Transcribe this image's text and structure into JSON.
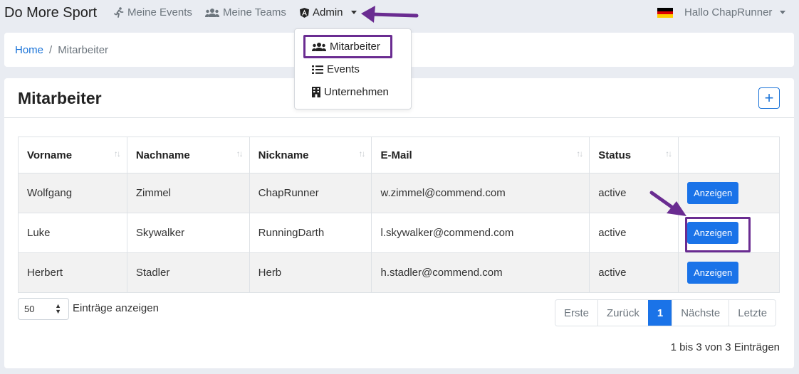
{
  "navbar": {
    "brand": "Do More Sport",
    "links": [
      {
        "label": "Meine Events",
        "icon": "running-icon"
      },
      {
        "label": "Meine Teams",
        "icon": "users-icon"
      },
      {
        "label": "Admin",
        "icon": "angular-icon"
      }
    ],
    "user_greeting": "Hallo ChapRunner",
    "language_flag": "german-flag-icon"
  },
  "dropdown": {
    "items": [
      {
        "label": "Mitarbeiter",
        "icon": "users-icon"
      },
      {
        "label": "Events",
        "icon": "list-icon"
      },
      {
        "label": "Unternehmen",
        "icon": "building-icon"
      }
    ]
  },
  "breadcrumb": {
    "home": "Home",
    "separator": "/",
    "current": "Mitarbeiter"
  },
  "page": {
    "title": "Mitarbeiter",
    "add_label": "+"
  },
  "table": {
    "headers": [
      "Vorname",
      "Nachname",
      "Nickname",
      "E-Mail",
      "Status"
    ],
    "sort_glyph": "↑↓",
    "rows": [
      {
        "vorname": "Wolfgang",
        "nachname": "Zimmel",
        "nickname": "ChapRunner",
        "email": "w.zimmel@commend.com",
        "status": "active",
        "action": "Anzeigen"
      },
      {
        "vorname": "Luke",
        "nachname": "Skywalker",
        "nickname": "RunningDarth",
        "email": "l.skywalker@commend.com",
        "status": "active",
        "action": "Anzeigen"
      },
      {
        "vorname": "Herbert",
        "nachname": "Stadler",
        "nickname": "Herb",
        "email": "h.stadler@commend.com",
        "status": "active",
        "action": "Anzeigen"
      }
    ]
  },
  "length_menu": {
    "value": "50",
    "label": "Einträge anzeigen"
  },
  "pagination": {
    "first": "Erste",
    "prev": "Zurück",
    "current": "1",
    "next": "Nächste",
    "last": "Letzte"
  },
  "info": "1 bis 3 von 3 Einträgen",
  "colors": {
    "accent": "#1a73e8",
    "highlight": "#6a2c91"
  }
}
